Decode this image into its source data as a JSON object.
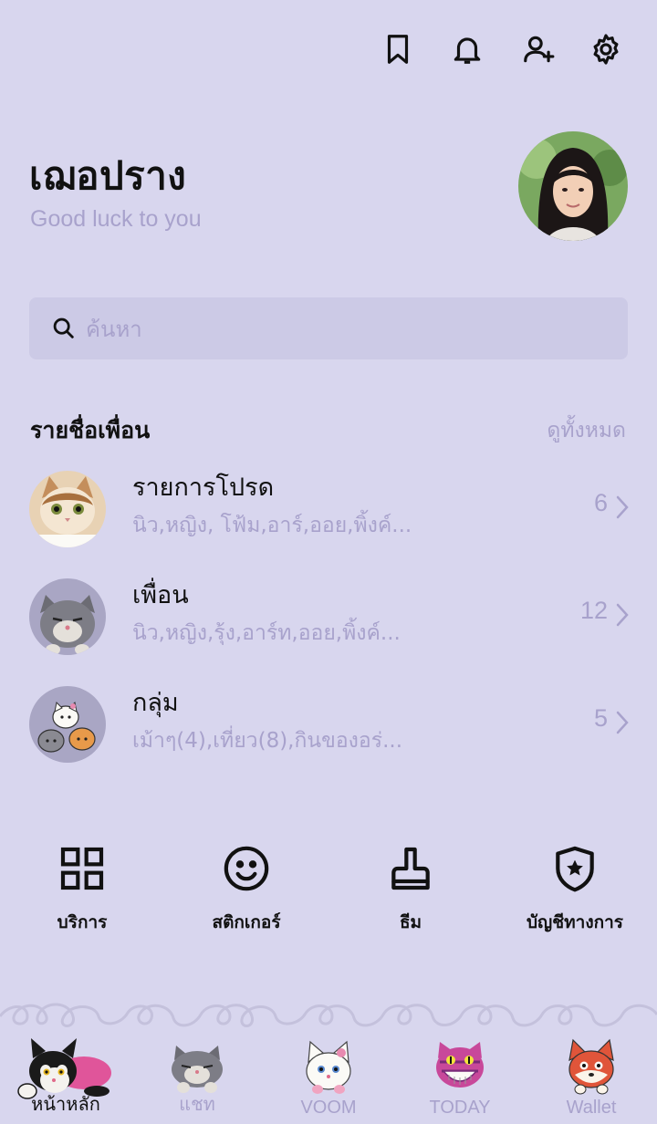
{
  "header": {
    "icons": [
      "bookmark-icon",
      "bell-icon",
      "add-friend-icon",
      "gear-icon"
    ]
  },
  "profile": {
    "name": "เฌอปราง",
    "status": "Good luck to you"
  },
  "search": {
    "placeholder": "ค้นหา"
  },
  "friends_section": {
    "title": "รายชื่อเพื่อน",
    "see_all": "ดูทั้งหมด",
    "items": [
      {
        "label": "รายการโปรด",
        "members": "นิว,หญิง, โฟ้ม,อาร์,ออย,พิ้งค์...",
        "count": "6"
      },
      {
        "label": "เพื่อน",
        "members": "นิว,หญิง,รุ้ง,อาร์ท,ออย,พิ้งค์...",
        "count": "12"
      },
      {
        "label": "กลุ่ม",
        "members": "เม้าๆ(4),เที่ยว(8),กินของอร่...",
        "count": "5"
      }
    ]
  },
  "services": [
    {
      "label": "บริการ",
      "icon": "grid-icon"
    },
    {
      "label": "สติกเกอร์",
      "icon": "smiley-icon"
    },
    {
      "label": "ธีม",
      "icon": "paint-brush-icon"
    },
    {
      "label": "บัญชีทางการ",
      "icon": "shield-star-icon"
    }
  ],
  "tabbar": {
    "active": "home",
    "tabs": [
      {
        "label": "หน้าหลัก",
        "icon": "black-cat-icon"
      },
      {
        "label": "แชท",
        "icon": "grey-cat-icon"
      },
      {
        "label": "VOOM",
        "icon": "white-cat-icon"
      },
      {
        "label": "TODAY",
        "icon": "cheshire-cat-icon"
      },
      {
        "label": "Wallet",
        "icon": "fox-icon"
      }
    ]
  },
  "colors": {
    "background": "#d8d6ee",
    "muted_text": "#a8a2cc",
    "search_bg": "#cccae6"
  }
}
